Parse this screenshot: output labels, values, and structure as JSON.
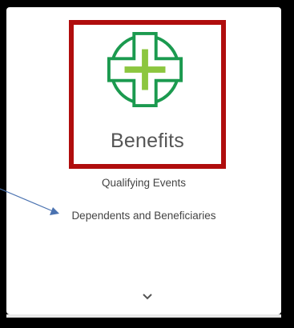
{
  "card": {
    "title": "Benefits",
    "links": [
      "Qualifying Events",
      "Dependents and Beneficiaries"
    ],
    "expand_icon": "chevron-down-icon"
  },
  "logo": {
    "icon": "medical-cross-icon",
    "colors": {
      "outer": "#1b9a4f",
      "inner": "#8cc63f"
    }
  },
  "annotation": {
    "highlight_color": "#b00d0d",
    "arrow_color": "#4a72b0"
  }
}
